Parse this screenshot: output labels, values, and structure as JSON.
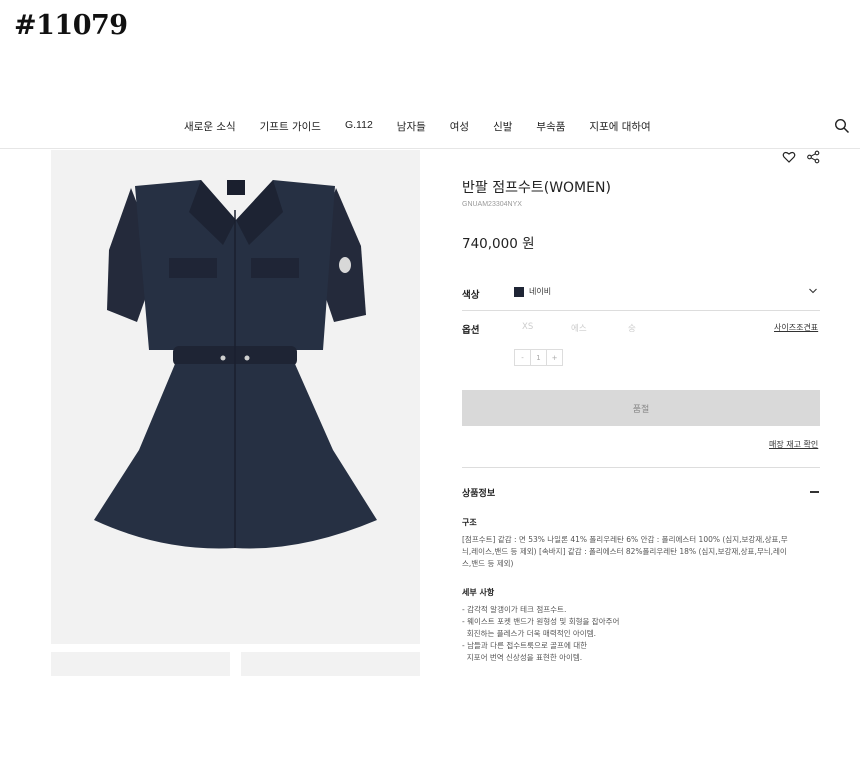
{
  "watermark": "#11079",
  "nav": {
    "items": [
      "새로운 소식",
      "기프트 가이드",
      "G.112",
      "남자들",
      "여성",
      "신발",
      "부속품",
      "지포에 대하여"
    ]
  },
  "icons": {
    "search": "search-icon",
    "wishlist": "heart-icon",
    "share": "share-icon",
    "chevron": "chevron-down-icon",
    "collapse": "minus-icon"
  },
  "product": {
    "title": "반팔 점프수트(WOMEN)",
    "code": "GNUAM23304NYX",
    "price": "740,000 원",
    "color_label": "색상",
    "color_name": "네이비",
    "color_hex": "#1f2535",
    "option_label": "옵션",
    "options": [
      "XS",
      "에스",
      "숭"
    ],
    "size_guide": "사이즈조견표",
    "stepper": {
      "minus": "-",
      "qty": "1",
      "plus": "+"
    },
    "soldout": "품절",
    "store_stock": "매장 재고 확인"
  },
  "info": {
    "title": "상품정보",
    "structure_title": "구조",
    "structure_lines": [
      "[점프수트] 같감 : 면 53% 나일론 41% 폴리우레탄 6% 안감 : 폴리에스터 100% (심지,보강재,상표,무",
      "늬,레이스,밴드 등 제외) [속바지] 같감 : 폴리에스터 82%폴리우레탄 18% (심지,보강재,상표,무늬,레이",
      "스,밴드 등 제외)"
    ],
    "detail_title": "세부 사항",
    "detail_lines": [
      "- 감각적 알갱이가 테크 점프수트.",
      "- 웨이스트 포켓 밴드가 원형성 및 회형을 잡아주어",
      "  회진하는 플레스가 더욱 매력적인 아이템.",
      "- 남들과 다른 접수트룩으로 골프에 대한",
      "  지포어 번역 신상성을 표현한 아이템."
    ]
  }
}
